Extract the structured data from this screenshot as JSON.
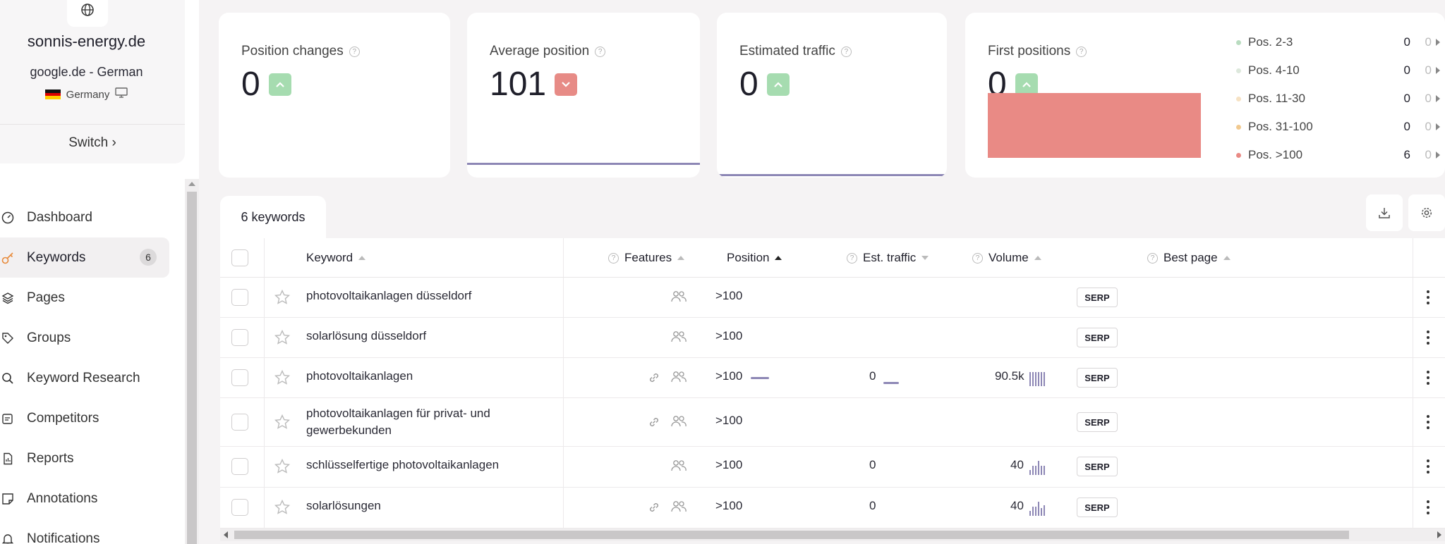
{
  "site": {
    "domain": "sonnis-energy.de",
    "engine": "google.de - German",
    "country": "Germany",
    "switch_label": "Switch ›"
  },
  "nav": [
    {
      "label": "Dashboard",
      "icon": "dashboard-icon"
    },
    {
      "label": "Keywords",
      "icon": "key-icon",
      "badge": "6",
      "active": true
    },
    {
      "label": "Pages",
      "icon": "layers-icon"
    },
    {
      "label": "Groups",
      "icon": "tag-icon"
    },
    {
      "label": "Keyword Research",
      "icon": "search-icon"
    },
    {
      "label": "Competitors",
      "icon": "competitors-icon"
    },
    {
      "label": "Reports",
      "icon": "report-icon"
    },
    {
      "label": "Annotations",
      "icon": "annotation-icon"
    },
    {
      "label": "Notifications",
      "icon": "bell-icon"
    }
  ],
  "stats": {
    "position_changes": {
      "title": "Position changes",
      "value": "0",
      "trend": "up"
    },
    "average_position": {
      "title": "Average position",
      "value": "101",
      "trend": "down"
    },
    "estimated_traffic": {
      "title": "Estimated traffic",
      "value": "0",
      "trend": "up"
    },
    "first_positions": {
      "title": "First positions",
      "value": "0",
      "trend": "up"
    }
  },
  "legend": [
    {
      "label": "Pos. 2-3",
      "value": "0",
      "change": "0",
      "color": "#b9dcc0"
    },
    {
      "label": "Pos. 4-10",
      "value": "0",
      "change": "0",
      "color": "#dde8dc"
    },
    {
      "label": "Pos. 11-30",
      "value": "0",
      "change": "0",
      "color": "#f6e2c4"
    },
    {
      "label": "Pos. 31-100",
      "value": "0",
      "change": "0",
      "color": "#f1c98f"
    },
    {
      "label": "Pos. >100",
      "value": "6",
      "change": "0",
      "color": "#e98a85"
    }
  ],
  "table": {
    "tab_label": "6 keywords",
    "headers": {
      "keyword": "Keyword",
      "features": "Features",
      "position": "Position",
      "est_traffic": "Est. traffic",
      "volume": "Volume",
      "best_page": "Best page"
    },
    "serp_label": "SERP",
    "rows": [
      {
        "keyword": "photovoltaikanlagen düsseldorf",
        "link": false,
        "position": ">100",
        "pos_spark": false,
        "traffic": "",
        "traffic_spark": false,
        "volume": "",
        "volume_bars": []
      },
      {
        "keyword": "solarlösung düsseldorf",
        "link": false,
        "position": ">100",
        "pos_spark": false,
        "traffic": "",
        "traffic_spark": false,
        "volume": "",
        "volume_bars": []
      },
      {
        "keyword": "photovoltaikanlagen",
        "link": true,
        "position": ">100",
        "pos_spark": true,
        "traffic": "0",
        "traffic_spark": true,
        "volume": "90.5k",
        "volume_bars": [
          0.9,
          0.9,
          0.9,
          0.9,
          0.9,
          0.9
        ]
      },
      {
        "keyword_line1": "photovoltaikanlagen für privat- und",
        "keyword_line2": "gewerbekunden",
        "link": true,
        "position": ">100",
        "pos_spark": false,
        "traffic": "",
        "traffic_spark": false,
        "volume": "",
        "volume_bars": []
      },
      {
        "keyword": "schlüsselfertige photovoltaikanlagen",
        "link": false,
        "position": ">100",
        "pos_spark": false,
        "traffic": "0",
        "traffic_spark": false,
        "volume": "40",
        "volume_bars": [
          0.3,
          0.6,
          0.6,
          1.0,
          0.6,
          0.6
        ]
      },
      {
        "keyword": "solarlösungen",
        "link": true,
        "position": ">100",
        "pos_spark": false,
        "traffic": "0",
        "traffic_spark": false,
        "volume": "40",
        "volume_bars": [
          0.3,
          0.6,
          0.6,
          1.0,
          0.5,
          0.7
        ]
      }
    ]
  },
  "colors": {
    "accent_line": "#8d87b5",
    "up": "#a6dcb0",
    "down": "#e78b86",
    "nav_active_icon": "#e88a3a"
  }
}
